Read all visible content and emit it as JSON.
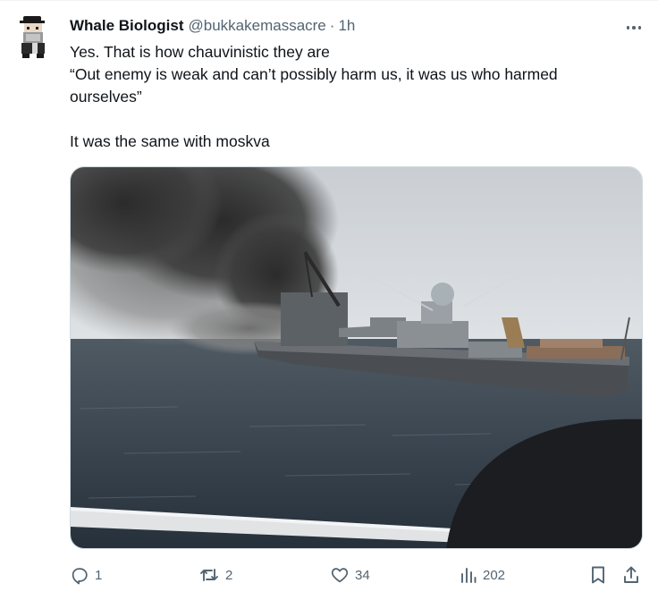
{
  "tweet": {
    "display_name": "Whale Biologist",
    "handle": "@bukkakemassacre",
    "separator": "·",
    "time": "1h",
    "lines": [
      "Yes. That is how chauvinistic they are",
      "“Out enemy is weak and can’t possibly harm us, it was us who harmed ourselves”",
      "It was the same with moskva"
    ]
  },
  "media": {
    "icons": {
      "subject": "burning-warship-photo"
    }
  },
  "actions": {
    "replies": "1",
    "reposts": "2",
    "likes": "34",
    "views": "202"
  },
  "colors": {
    "text": "#0f1419",
    "secondary": "#536471",
    "border": "#cfd9de"
  }
}
